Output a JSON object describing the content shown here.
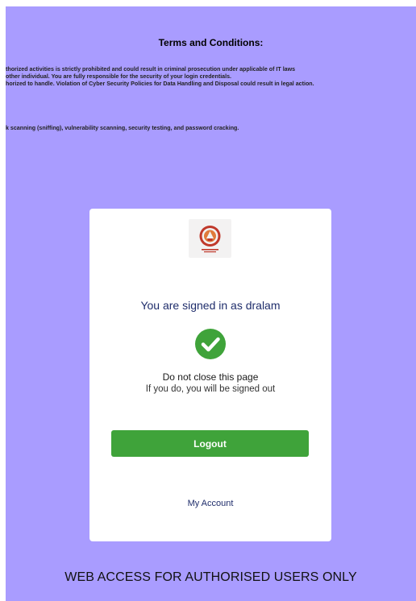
{
  "terms": {
    "title": "Terms and Conditions:",
    "lines": [
      "thorized activities is strictly prohibited and could result in criminal prosecution under applicable of IT laws",
      "other individual. You are fully responsible for the security of your login credentials.",
      "horized to handle. Violation of Cyber Security Policies for Data Handling and Disposal could result in legal action.",
      "k scanning (sniffing), vulnerability scanning, security testing, and password cracking."
    ]
  },
  "card": {
    "logo_icon": "institution-logo",
    "signed_in_text": "You are signed in as dralam",
    "status_icon": "check-circle-icon",
    "warning_title": "Do not close this page",
    "warning_subtitle": "If you do, you will be signed out",
    "logout_label": "Logout",
    "my_account_label": "My Account"
  },
  "footer": {
    "text": "WEB ACCESS FOR AUTHORISED USERS ONLY"
  },
  "colors": {
    "background": "#a99cff",
    "card": "#ffffff",
    "logout_button": "#3fa33a",
    "check_icon": "#3fa33a",
    "primary_text": "#1f2d6b",
    "logo_red": "#c0392b"
  }
}
